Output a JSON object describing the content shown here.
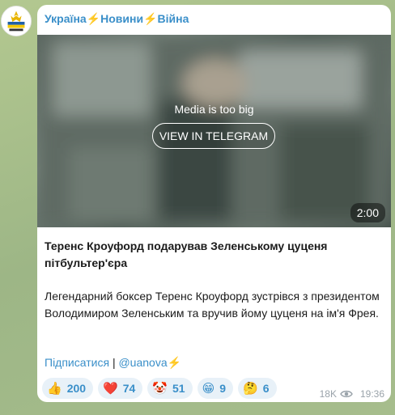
{
  "channel": {
    "title_parts": [
      "Україна",
      "Новини",
      "Війна"
    ],
    "bolt": "⚡",
    "avatar_icon": "channel-avatar-icon"
  },
  "media": {
    "notice": "Media is too big",
    "button_label": "VIEW IN TELEGRAM",
    "duration": "2:00"
  },
  "post": {
    "headline": "Теренс Кроуфорд подарував Зеленському цуценя пітбультер'єра",
    "body": "Легендарний боксер Теренс Кроуфорд зустрівся з президентом Володимиром Зеленським та вручив йому цуценя на ім'я Фрея.",
    "subscribe_label": "Підписатися",
    "separator": "|",
    "handle": "@uanova",
    "handle_bolt": "⚡"
  },
  "reactions": [
    {
      "emoji": "👍",
      "count": "200"
    },
    {
      "emoji": "❤️",
      "count": "74"
    },
    {
      "emoji": "🤡",
      "count": "51"
    },
    {
      "emoji": "😁",
      "count": "9"
    },
    {
      "emoji": "🤔",
      "count": "6"
    }
  ],
  "meta": {
    "views": "18K",
    "time": "19:36",
    "views_icon": "eye-icon"
  },
  "colors": {
    "accent": "#3a8fc9",
    "bolt": "#f5b400",
    "reaction_bg": "#e8f1f8",
    "chat_bg": "#a9bf8e"
  }
}
